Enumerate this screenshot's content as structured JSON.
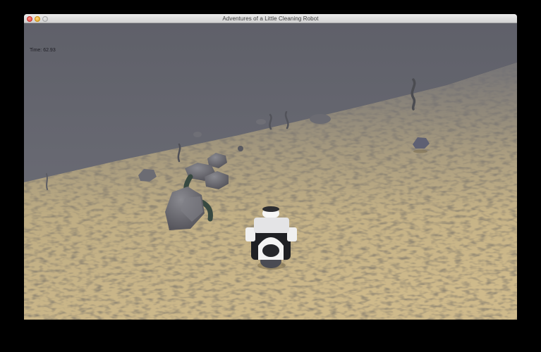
{
  "window": {
    "title": "Adventures of a Little Cleaning Robot"
  },
  "hud": {
    "time_label": "Time:",
    "time_value": "62.93"
  },
  "colors": {
    "fog": "#6a6b75",
    "sand": "#c8b58a",
    "rock": "#6f6e74",
    "robot_body": "#f2f2f2",
    "robot_dark": "#2a2a2e"
  },
  "icons": {
    "close": "close-button-icon",
    "minimize": "minimize-button-icon",
    "maximize": "maximize-button-icon"
  }
}
